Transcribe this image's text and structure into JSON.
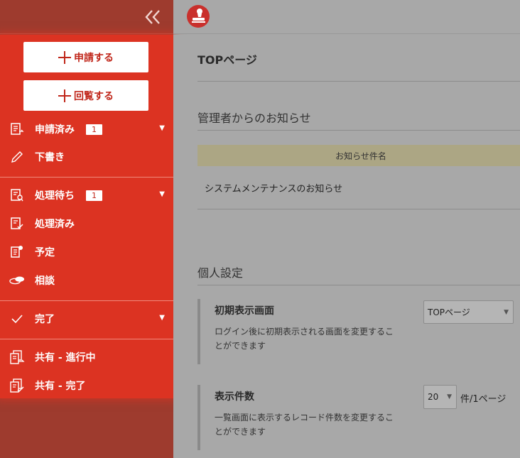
{
  "sidebar": {
    "apply_label": "申請する",
    "circulate_label": "回覧する",
    "items": [
      {
        "label": "申請済み",
        "badge": "1"
      },
      {
        "label": "下書き"
      },
      {
        "label": "処理待ち",
        "badge": "1"
      },
      {
        "label": "処理済み"
      },
      {
        "label": "予定"
      },
      {
        "label": "相談"
      },
      {
        "label": "完了"
      },
      {
        "label": "共有 - 進行中"
      },
      {
        "label": "共有 - 完了"
      }
    ]
  },
  "main": {
    "page_title": "TOPページ",
    "notice": {
      "title": "管理者からのお知らせ",
      "column_header": "お知らせ件名",
      "rows": [
        "システムメンテナンスのお知らせ"
      ]
    },
    "personal": {
      "title": "個人設定",
      "initial_screen": {
        "label": "初期表示画面",
        "description": "ログイン後に初期表示される画面を変更することができます",
        "selected": "TOPページ"
      },
      "display_count": {
        "label": "表示件数",
        "description": "一覧画面に表示するレコード件数を変更することができます",
        "selected": "20",
        "unit": "件/1ページ"
      }
    }
  },
  "colors": {
    "sidebar_red": "#dc3322",
    "sidebar_dark": "#9e3b2e",
    "overlay_gray": "#a8a8a8",
    "notice_header": "#aca684"
  }
}
